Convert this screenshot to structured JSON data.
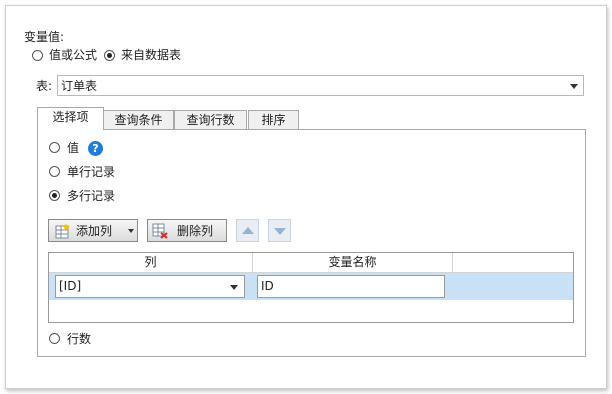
{
  "section": {
    "title": "变量值:"
  },
  "source_radios": [
    {
      "label": "值或公式",
      "selected": false
    },
    {
      "label": "来自数据表",
      "selected": true
    }
  ],
  "table_select": {
    "label": "表:",
    "value": "订单表"
  },
  "tabs": [
    {
      "label": "选择项",
      "active": true
    },
    {
      "label": "查询条件",
      "active": false
    },
    {
      "label": "查询行数",
      "active": false
    },
    {
      "label": "排序",
      "active": false
    }
  ],
  "mode_radios": [
    {
      "label": "值",
      "selected": false
    },
    {
      "label": "单行记录",
      "selected": false
    },
    {
      "label": "多行记录",
      "selected": true
    }
  ],
  "help_icon": "?",
  "toolbar": {
    "add_column": "添加列",
    "delete_column": "删除列"
  },
  "grid": {
    "headers": [
      "列",
      "变量名称"
    ],
    "rows": [
      {
        "column": "[ID]",
        "var_name": "ID"
      }
    ]
  },
  "row_count_radio": {
    "label": "行数",
    "selected": false
  },
  "colors": {
    "accent": "#1e7fd4",
    "row_selected": "#c9e1f7",
    "arrow_disabled": "#97b3d3"
  }
}
